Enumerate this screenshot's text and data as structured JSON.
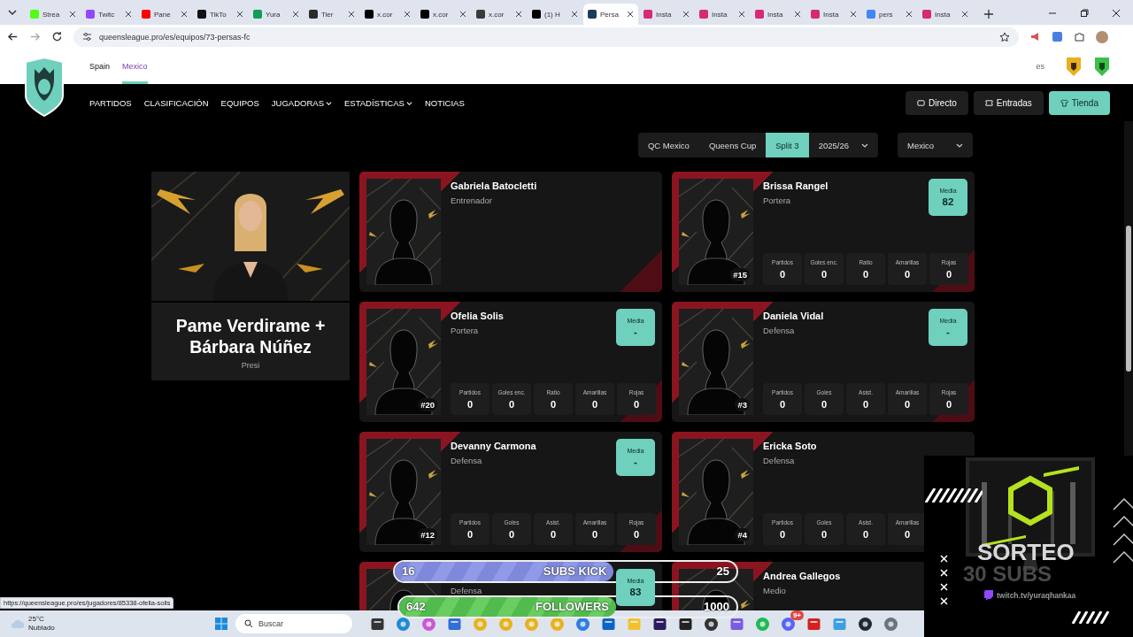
{
  "browser": {
    "tabs": [
      {
        "title": "Strea",
        "kind": "kick",
        "selected": false
      },
      {
        "title": "Twitc",
        "kind": "twitch",
        "selected": false
      },
      {
        "title": "Pane",
        "kind": "youtube",
        "selected": false
      },
      {
        "title": "TikTo",
        "kind": "tiktok",
        "selected": false
      },
      {
        "title": "Yura",
        "kind": "sheets",
        "selected": false
      },
      {
        "title": "Tier",
        "kind": "tier",
        "selected": false
      },
      {
        "title": "x.cor",
        "kind": "x",
        "selected": false
      },
      {
        "title": "x.cor",
        "kind": "x",
        "selected": false
      },
      {
        "title": "x.cor",
        "kind": "xcircle",
        "selected": false
      },
      {
        "title": "(1) H",
        "kind": "x",
        "selected": false
      },
      {
        "title": "Persa",
        "kind": "league",
        "selected": true
      },
      {
        "title": "Insta",
        "kind": "instagram",
        "selected": false
      },
      {
        "title": "Insta",
        "kind": "instagram",
        "selected": false
      },
      {
        "title": "Insta",
        "kind": "instagram",
        "selected": false
      },
      {
        "title": "Insta",
        "kind": "instagram",
        "selected": false
      },
      {
        "title": "pers",
        "kind": "google",
        "selected": false
      },
      {
        "title": "Insta",
        "kind": "instagram",
        "selected": false
      }
    ],
    "url": "queensleague.pro/es/equipos/73-persas-fc",
    "status_url": "https://queensleague.pro/es/jugadores/85338-ofelia-solis"
  },
  "site": {
    "regions": [
      {
        "label": "Spain",
        "selected": false
      },
      {
        "label": "Mexico",
        "selected": true
      }
    ],
    "language": "es",
    "nav": [
      {
        "label": "PARTIDOS",
        "dropdown": false
      },
      {
        "label": "CLASIFICACIÓN",
        "dropdown": false
      },
      {
        "label": "EQUIPOS",
        "dropdown": false
      },
      {
        "label": "JUGADORAS",
        "dropdown": true
      },
      {
        "label": "ESTADÍSTICAS",
        "dropdown": true
      },
      {
        "label": "NOTICIAS",
        "dropdown": false
      }
    ],
    "actions": [
      {
        "label": "Directo",
        "kind": "live"
      },
      {
        "label": "Entradas",
        "kind": "tickets"
      },
      {
        "label": "Tienda",
        "kind": "shop"
      }
    ]
  },
  "filters": {
    "segments": [
      {
        "label": "QC Mexico",
        "selected": false,
        "dropdown": false
      },
      {
        "label": "Queens Cup",
        "selected": false,
        "dropdown": false
      },
      {
        "label": "Split 3",
        "selected": true,
        "dropdown": false
      },
      {
        "label": "2025/26",
        "selected": false,
        "dropdown": true
      }
    ],
    "country": "Mexico"
  },
  "president": {
    "name": "Pame Verdirame + Bárbara Núñez",
    "role": "Presi"
  },
  "players": [
    {
      "name": "Gabriela Batocletti",
      "role": "Entrenador"
    },
    {
      "name": "Brissa Rangel",
      "role": "Portera",
      "number": "#15",
      "media": {
        "label": "Media",
        "value": "82"
      },
      "stats": [
        {
          "label": "Partidos",
          "value": "0"
        },
        {
          "label": "Goles enc.",
          "value": "0"
        },
        {
          "label": "Ratio",
          "value": "0"
        },
        {
          "label": "Amarillas",
          "value": "0"
        },
        {
          "label": "Rojas",
          "value": "0"
        }
      ]
    },
    {
      "name": "Ofelia Solis",
      "role": "Portera",
      "number": "#20",
      "media": {
        "label": "Media",
        "value": "-"
      },
      "stats": [
        {
          "label": "Partidos",
          "value": "0"
        },
        {
          "label": "Goles enc.",
          "value": "0"
        },
        {
          "label": "Ratio",
          "value": "0"
        },
        {
          "label": "Amarillas",
          "value": "0"
        },
        {
          "label": "Rojas",
          "value": "0"
        }
      ]
    },
    {
      "name": "Daniela Vidal",
      "role": "Defensa",
      "number": "#3",
      "media": {
        "label": "Media",
        "value": "-"
      },
      "stats": [
        {
          "label": "Partidos",
          "value": "0"
        },
        {
          "label": "Goles",
          "value": "0"
        },
        {
          "label": "Asist.",
          "value": "0"
        },
        {
          "label": "Amarillas",
          "value": "0"
        },
        {
          "label": "Rojas",
          "value": "0"
        }
      ]
    },
    {
      "name": "Devanny Carmona",
      "role": "Defensa",
      "number": "#12",
      "media": {
        "label": "Media",
        "value": "-"
      },
      "stats": [
        {
          "label": "Partidos",
          "value": "0"
        },
        {
          "label": "Goles",
          "value": "0"
        },
        {
          "label": "Asist.",
          "value": "0"
        },
        {
          "label": "Amarillas",
          "value": "0"
        },
        {
          "label": "Rojas",
          "value": "0"
        }
      ]
    },
    {
      "name": "Ericka Soto",
      "role": "Defensa",
      "number": "#4",
      "stats": [
        {
          "label": "Partidos",
          "value": "0"
        },
        {
          "label": "Goles",
          "value": "0"
        },
        {
          "label": "Asist.",
          "value": "0"
        },
        {
          "label": "Amarillas",
          "value": "0"
        }
      ]
    },
    {
      "role": "Defensa",
      "media": {
        "label": "Media",
        "value": "83"
      }
    },
    {
      "name": "Andrea Gallegos",
      "role": "Medio"
    }
  ],
  "stream_goals": [
    {
      "kind": "kick",
      "current": "16",
      "label": "SUBS KICK",
      "target": "25",
      "level": 0.64
    },
    {
      "kind": "followers",
      "current": "642",
      "label": "FOLLOWERS",
      "target": "1000",
      "level": 0.642
    }
  ],
  "promo": {
    "title": "SORTEO",
    "subtitle": "30 SUBS",
    "channel": "twitch.tv/yuraqhankaa"
  },
  "taskbar": {
    "temperature": "25°C",
    "weather": "Nublado",
    "search_placeholder": "Buscar",
    "chat_badge": "9+"
  }
}
